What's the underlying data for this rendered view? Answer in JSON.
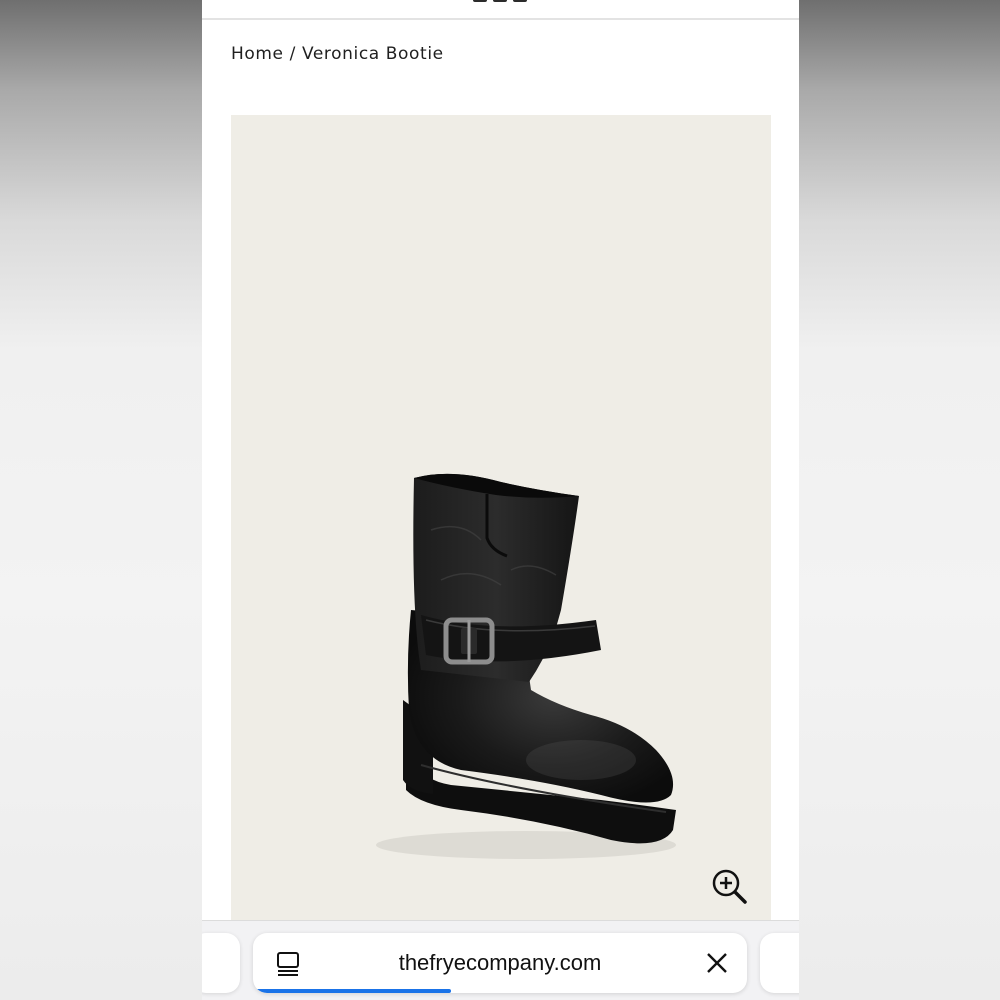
{
  "breadcrumb": {
    "home": "Home",
    "separator": "/",
    "current": "Veronica Bootie"
  },
  "product": {
    "image_alt": "Veronica Bootie",
    "background": "#efede6",
    "zoom_icon": "zoom-in-icon"
  },
  "browser": {
    "url": "thefryecompany.com",
    "tabs_icon": "tabs-icon",
    "close_icon": "close-icon",
    "load_progress": 0.4,
    "accent": "#1a73e8"
  }
}
